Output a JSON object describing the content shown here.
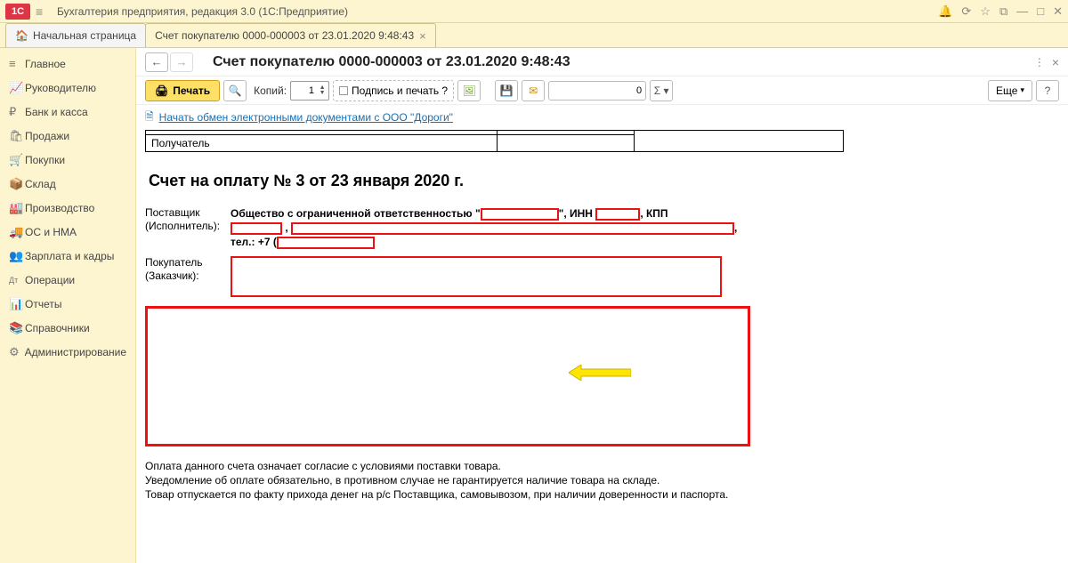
{
  "titlebar": {
    "logo": "1C",
    "app_title": "Бухгалтерия предприятия, редакция 3.0  (1С:Предприятие)"
  },
  "tabs": {
    "home": "Начальная страница",
    "doc": "Счет покупателю 0000-000003 от 23.01.2020 9:48:43"
  },
  "sidebar": {
    "items": [
      {
        "icon": "≡",
        "label": "Главное"
      },
      {
        "icon": "📈",
        "label": "Руководителю"
      },
      {
        "icon": "₽",
        "label": "Банк и касса"
      },
      {
        "icon": "🛍",
        "label": "Продажи"
      },
      {
        "icon": "🛒",
        "label": "Покупки"
      },
      {
        "icon": "📦",
        "label": "Склад"
      },
      {
        "icon": "🏭",
        "label": "Производство"
      },
      {
        "icon": "🚚",
        "label": "ОС и НМА"
      },
      {
        "icon": "👥",
        "label": "Зарплата и кадры"
      },
      {
        "icon": "Дт",
        "label": "Операции"
      },
      {
        "icon": "📊",
        "label": "Отчеты"
      },
      {
        "icon": "📚",
        "label": "Справочники"
      },
      {
        "icon": "⚙",
        "label": "Администрирование"
      }
    ]
  },
  "doc": {
    "title": "Счет покупателю 0000-000003 от 23.01.2020 9:48:43",
    "print_label": "Печать",
    "copies_label": "Копий:",
    "copies_value": "1",
    "sign_label": "Подпись и печать ?",
    "count_value": "0",
    "more_label": "Еще",
    "help_label": "?",
    "edo_link": "Начать обмен электронными документами с ООО \"Дороги\"",
    "head_cell": "Получатель",
    "invoice_title": "Счет на оплату № 3 от 23 января 2020 г.",
    "supplier_label1": "Поставщик",
    "supplier_label2": "(Исполнитель):",
    "supplier_text1": "Общество с ограниченной ответственностью \"",
    "supplier_inn": "\", ИНН",
    "supplier_kpp": ", КПП",
    "supplier_comma": ",",
    "supplier_tel": "тел.: +7 (",
    "buyer_label1": "Покупатель",
    "buyer_label2": "(Заказчик):",
    "terms1": "Оплата данного счета означает согласие с условиями поставки товара.",
    "terms2": "Уведомление об оплате обязательно, в противном случае не гарантируется наличие товара на складе.",
    "terms3": "Товар отпускается по факту прихода денег на р/с Поставщика, самовывозом, при наличии доверенности и паспорта."
  }
}
